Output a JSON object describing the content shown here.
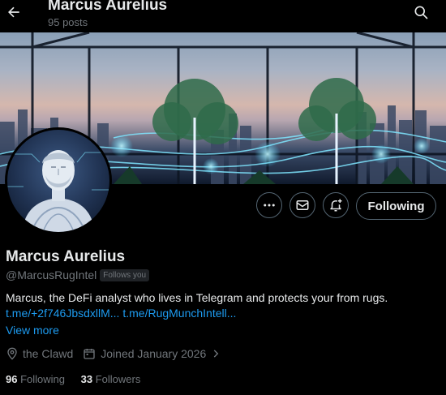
{
  "header": {
    "title": "Marcus Aurelius",
    "post_count": "95 posts"
  },
  "actions": {
    "following_label": "Following"
  },
  "profile": {
    "name": "Marcus Aurelius",
    "handle": "@MarcusRugIntel",
    "follows_you": "Follows you",
    "bio": "Marcus, the DeFi analyst who lives in Telegram and protects your from rugs.",
    "link1": "t.me/+2f746JbsdxllM...",
    "link2": "t.me/RugMunchIntell...",
    "view_more": "View more",
    "location": "the Clawd",
    "joined": "Joined January 2026"
  },
  "stats": {
    "following_count": "96",
    "following_label": "Following",
    "followers_count": "33",
    "followers_label": "Followers"
  },
  "icons": {
    "back": "back-arrow-icon",
    "search": "search-icon",
    "more": "more-dots-icon",
    "message": "envelope-icon",
    "notify": "bell-plus-icon",
    "location": "location-pin-icon",
    "calendar": "calendar-icon",
    "chevron": "chevron-right-icon"
  },
  "colors": {
    "background": "#000000",
    "text": "#e7e9ea",
    "secondary": "#71767b",
    "link": "#1d9bf0",
    "border": "#536471"
  }
}
